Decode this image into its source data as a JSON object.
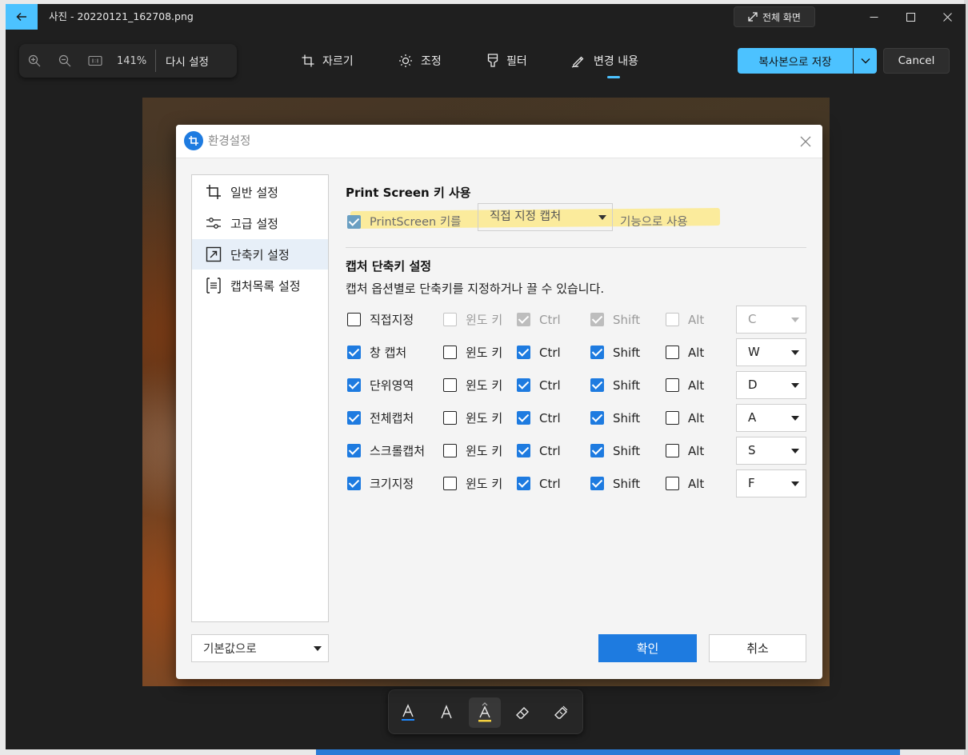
{
  "window": {
    "title": "사진 - 20220121_162708.png",
    "fullscreen_label": "전체 화면"
  },
  "toolbar": {
    "zoom_percent": "141%",
    "reset_label": "다시 설정",
    "tools": [
      {
        "label": "자르기",
        "icon": "crop-icon"
      },
      {
        "label": "조정",
        "icon": "brightness-icon"
      },
      {
        "label": "필터",
        "icon": "filter-icon"
      },
      {
        "label": "변경 내용",
        "icon": "markup-pen-icon",
        "active": true
      }
    ],
    "save_label": "복사본으로 저장",
    "cancel_label": "Cancel"
  },
  "dialog": {
    "title": "환경설정",
    "sidebar": [
      {
        "label": "일반 설정",
        "icon": "crop-icon"
      },
      {
        "label": "고급 설정",
        "icon": "sliders-icon"
      },
      {
        "label": "단축키 설정",
        "icon": "shortcut-icon",
        "selected": true
      },
      {
        "label": "캡처목록 설정",
        "icon": "capture-list-icon"
      }
    ],
    "default_select": "기본값으로",
    "printscreen": {
      "section_title": "Print Screen 키 사용",
      "prefix": "PrintScreen 키를",
      "selected_option": "직접 지정 캡처",
      "suffix": "기능으로 사용",
      "checked": true
    },
    "shortcuts": {
      "section_title": "캡처 단축키 설정",
      "description": "캡처 옵션별로 단축키를 지정하거나 끌 수 있습니다.",
      "modifier_labels": {
        "win": "윈도 키",
        "ctrl": "Ctrl",
        "shift": "Shift",
        "alt": "Alt"
      },
      "rows": [
        {
          "name": "직접지정",
          "enabled": false,
          "win": false,
          "ctrl": true,
          "shift": true,
          "alt": false,
          "key": "C"
        },
        {
          "name": "창 캡처",
          "enabled": true,
          "win": false,
          "ctrl": true,
          "shift": true,
          "alt": false,
          "key": "W"
        },
        {
          "name": "단위영역",
          "enabled": true,
          "win": false,
          "ctrl": true,
          "shift": true,
          "alt": false,
          "key": "D"
        },
        {
          "name": "전체캡처",
          "enabled": true,
          "win": false,
          "ctrl": true,
          "shift": true,
          "alt": false,
          "key": "A"
        },
        {
          "name": "스크롤캡처",
          "enabled": true,
          "win": false,
          "ctrl": true,
          "shift": true,
          "alt": false,
          "key": "S"
        },
        {
          "name": "크기지정",
          "enabled": true,
          "win": false,
          "ctrl": true,
          "shift": true,
          "alt": false,
          "key": "F"
        }
      ]
    },
    "ok_label": "확인",
    "cancel_label": "취소"
  },
  "pen_tools": [
    {
      "icon": "ballpoint-pen-icon"
    },
    {
      "icon": "pencil-icon"
    },
    {
      "icon": "highlighter-icon",
      "active": true
    },
    {
      "icon": "eraser-icon"
    },
    {
      "icon": "clear-all-icon"
    }
  ],
  "colors": {
    "accent": "#4cc2ff",
    "dialog_accent": "#1e7be0",
    "highlight": "#fbeb9c"
  }
}
